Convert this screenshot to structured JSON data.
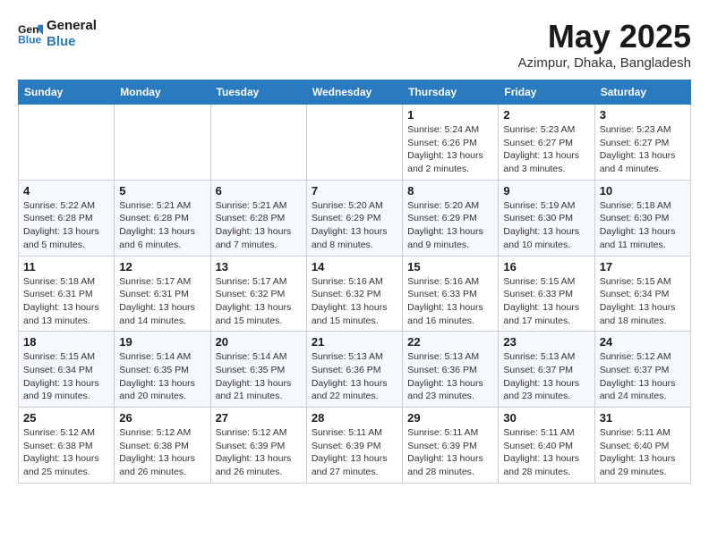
{
  "header": {
    "logo_line1": "General",
    "logo_line2": "Blue",
    "month": "May 2025",
    "location": "Azimpur, Dhaka, Bangladesh"
  },
  "weekdays": [
    "Sunday",
    "Monday",
    "Tuesday",
    "Wednesday",
    "Thursday",
    "Friday",
    "Saturday"
  ],
  "rows": [
    [
      {
        "day": "",
        "info": ""
      },
      {
        "day": "",
        "info": ""
      },
      {
        "day": "",
        "info": ""
      },
      {
        "day": "",
        "info": ""
      },
      {
        "day": "1",
        "info": "Sunrise: 5:24 AM\nSunset: 6:26 PM\nDaylight: 13 hours\nand 2 minutes."
      },
      {
        "day": "2",
        "info": "Sunrise: 5:23 AM\nSunset: 6:27 PM\nDaylight: 13 hours\nand 3 minutes."
      },
      {
        "day": "3",
        "info": "Sunrise: 5:23 AM\nSunset: 6:27 PM\nDaylight: 13 hours\nand 4 minutes."
      }
    ],
    [
      {
        "day": "4",
        "info": "Sunrise: 5:22 AM\nSunset: 6:28 PM\nDaylight: 13 hours\nand 5 minutes."
      },
      {
        "day": "5",
        "info": "Sunrise: 5:21 AM\nSunset: 6:28 PM\nDaylight: 13 hours\nand 6 minutes."
      },
      {
        "day": "6",
        "info": "Sunrise: 5:21 AM\nSunset: 6:28 PM\nDaylight: 13 hours\nand 7 minutes."
      },
      {
        "day": "7",
        "info": "Sunrise: 5:20 AM\nSunset: 6:29 PM\nDaylight: 13 hours\nand 8 minutes."
      },
      {
        "day": "8",
        "info": "Sunrise: 5:20 AM\nSunset: 6:29 PM\nDaylight: 13 hours\nand 9 minutes."
      },
      {
        "day": "9",
        "info": "Sunrise: 5:19 AM\nSunset: 6:30 PM\nDaylight: 13 hours\nand 10 minutes."
      },
      {
        "day": "10",
        "info": "Sunrise: 5:18 AM\nSunset: 6:30 PM\nDaylight: 13 hours\nand 11 minutes."
      }
    ],
    [
      {
        "day": "11",
        "info": "Sunrise: 5:18 AM\nSunset: 6:31 PM\nDaylight: 13 hours\nand 13 minutes."
      },
      {
        "day": "12",
        "info": "Sunrise: 5:17 AM\nSunset: 6:31 PM\nDaylight: 13 hours\nand 14 minutes."
      },
      {
        "day": "13",
        "info": "Sunrise: 5:17 AM\nSunset: 6:32 PM\nDaylight: 13 hours\nand 15 minutes."
      },
      {
        "day": "14",
        "info": "Sunrise: 5:16 AM\nSunset: 6:32 PM\nDaylight: 13 hours\nand 15 minutes."
      },
      {
        "day": "15",
        "info": "Sunrise: 5:16 AM\nSunset: 6:33 PM\nDaylight: 13 hours\nand 16 minutes."
      },
      {
        "day": "16",
        "info": "Sunrise: 5:15 AM\nSunset: 6:33 PM\nDaylight: 13 hours\nand 17 minutes."
      },
      {
        "day": "17",
        "info": "Sunrise: 5:15 AM\nSunset: 6:34 PM\nDaylight: 13 hours\nand 18 minutes."
      }
    ],
    [
      {
        "day": "18",
        "info": "Sunrise: 5:15 AM\nSunset: 6:34 PM\nDaylight: 13 hours\nand 19 minutes."
      },
      {
        "day": "19",
        "info": "Sunrise: 5:14 AM\nSunset: 6:35 PM\nDaylight: 13 hours\nand 20 minutes."
      },
      {
        "day": "20",
        "info": "Sunrise: 5:14 AM\nSunset: 6:35 PM\nDaylight: 13 hours\nand 21 minutes."
      },
      {
        "day": "21",
        "info": "Sunrise: 5:13 AM\nSunset: 6:36 PM\nDaylight: 13 hours\nand 22 minutes."
      },
      {
        "day": "22",
        "info": "Sunrise: 5:13 AM\nSunset: 6:36 PM\nDaylight: 13 hours\nand 23 minutes."
      },
      {
        "day": "23",
        "info": "Sunrise: 5:13 AM\nSunset: 6:37 PM\nDaylight: 13 hours\nand 23 minutes."
      },
      {
        "day": "24",
        "info": "Sunrise: 5:12 AM\nSunset: 6:37 PM\nDaylight: 13 hours\nand 24 minutes."
      }
    ],
    [
      {
        "day": "25",
        "info": "Sunrise: 5:12 AM\nSunset: 6:38 PM\nDaylight: 13 hours\nand 25 minutes."
      },
      {
        "day": "26",
        "info": "Sunrise: 5:12 AM\nSunset: 6:38 PM\nDaylight: 13 hours\nand 26 minutes."
      },
      {
        "day": "27",
        "info": "Sunrise: 5:12 AM\nSunset: 6:39 PM\nDaylight: 13 hours\nand 26 minutes."
      },
      {
        "day": "28",
        "info": "Sunrise: 5:11 AM\nSunset: 6:39 PM\nDaylight: 13 hours\nand 27 minutes."
      },
      {
        "day": "29",
        "info": "Sunrise: 5:11 AM\nSunset: 6:39 PM\nDaylight: 13 hours\nand 28 minutes."
      },
      {
        "day": "30",
        "info": "Sunrise: 5:11 AM\nSunset: 6:40 PM\nDaylight: 13 hours\nand 28 minutes."
      },
      {
        "day": "31",
        "info": "Sunrise: 5:11 AM\nSunset: 6:40 PM\nDaylight: 13 hours\nand 29 minutes."
      }
    ]
  ]
}
